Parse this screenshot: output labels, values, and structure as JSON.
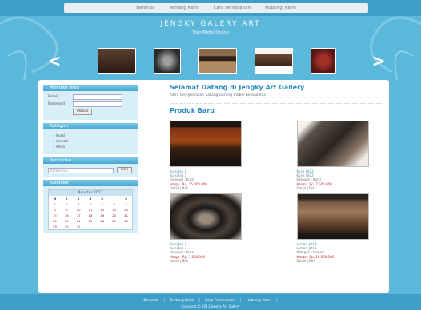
{
  "nav": {
    "items": [
      "Beranda",
      "Tentang Kami",
      "Cara Pemesanan",
      "Hubungi Kami"
    ]
  },
  "header": {
    "title": "JENGKY GALERY ART",
    "subtitle": "Toko Mebel Online"
  },
  "slider": {
    "prev_icon": "chevron-left-icon",
    "next_icon": "chevron-right-icon"
  },
  "sidebar": {
    "member": {
      "title": "Member Area",
      "email_label": "Email",
      "password_label": "Password",
      "button_label": "Masuk"
    },
    "category": {
      "title": "Kategori",
      "items": [
        "Kursi",
        "Lemari",
        "Meja"
      ]
    },
    "search": {
      "title": "Pencarian",
      "placeholder": "Kata kunci...",
      "button_label": "Cari"
    },
    "calendar": {
      "title": "Kalender",
      "month_label": "Agustus 2011",
      "day_names": [
        "M",
        "S",
        "S",
        "R",
        "K",
        "J",
        "S"
      ],
      "days": [
        "1",
        "2",
        "3",
        "4",
        "5",
        "6",
        "7",
        "8",
        "9",
        "10",
        "11",
        "12",
        "13",
        "14",
        "15",
        "16",
        "17",
        "18",
        "19",
        "20",
        "21",
        "22",
        "23",
        "24",
        "25",
        "26",
        "27",
        "28",
        "29",
        "30",
        "31"
      ]
    }
  },
  "content": {
    "welcome_title": "Selamat Datang di Jengky Art Gallery",
    "welcome_sub": "Kami menyediakan barang-barang mebel berkualitas",
    "products_title": "Produk Baru",
    "products": [
      {
        "name": "Kursi Jati 1",
        "detail": "Kursi Jati 1",
        "category": "Kategori : Kursi",
        "price": "Harga : Rp. 15.000.000",
        "status": "Detail | Beli"
      },
      {
        "name": "Kursi Jati 2",
        "detail": "Kursi Jati 2",
        "category": "Kategori : Kursi",
        "price": "Harga : Rp. 7.500.000",
        "status": "Detail | Beli"
      },
      {
        "name": "Kursi Jati 3",
        "detail": "Kursi Jati 3 ...",
        "category": "Kategori : Kursi",
        "price": "Harga : Rp. 5.000.000",
        "status": "Detail | Beli"
      },
      {
        "name": "Lemari Jati 1",
        "detail": "Lemari Jati 1",
        "category": "Kategori : Lemari",
        "price": "Harga : Rp. 10.000.000",
        "status": "Detail | Beli"
      }
    ]
  },
  "footer": {
    "links": [
      "Beranda",
      "Tentang Kami",
      "Cara Pemesanan",
      "Hubungi Kami"
    ],
    "copyright": "Copyright © 2011 Jengky Art Gallery"
  }
}
